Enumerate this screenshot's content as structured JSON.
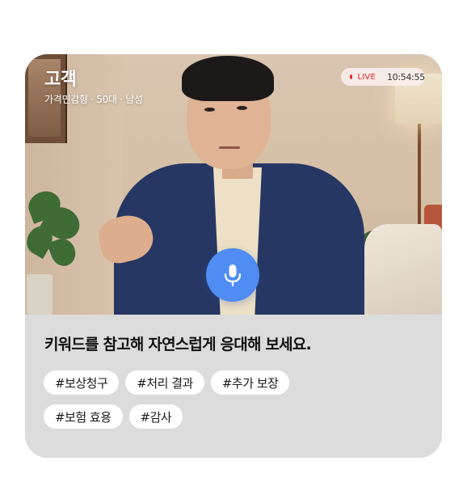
{
  "customer": {
    "name": "고객",
    "meta": "가격민감형 · 50대 · 남성"
  },
  "live": {
    "label": "LIVE",
    "time": "10:54:55",
    "accent_color": "#e52424"
  },
  "mic": {
    "icon": "microphone-icon",
    "color": "#4f8cf4"
  },
  "prompt": {
    "text": "키워드를 참고해 자연스럽게 응대해 보세요."
  },
  "tags": [
    [
      "#보상청구",
      "#처리 결과",
      "#추가 보장"
    ],
    [
      "#보험 효용",
      "#감사"
    ]
  ]
}
